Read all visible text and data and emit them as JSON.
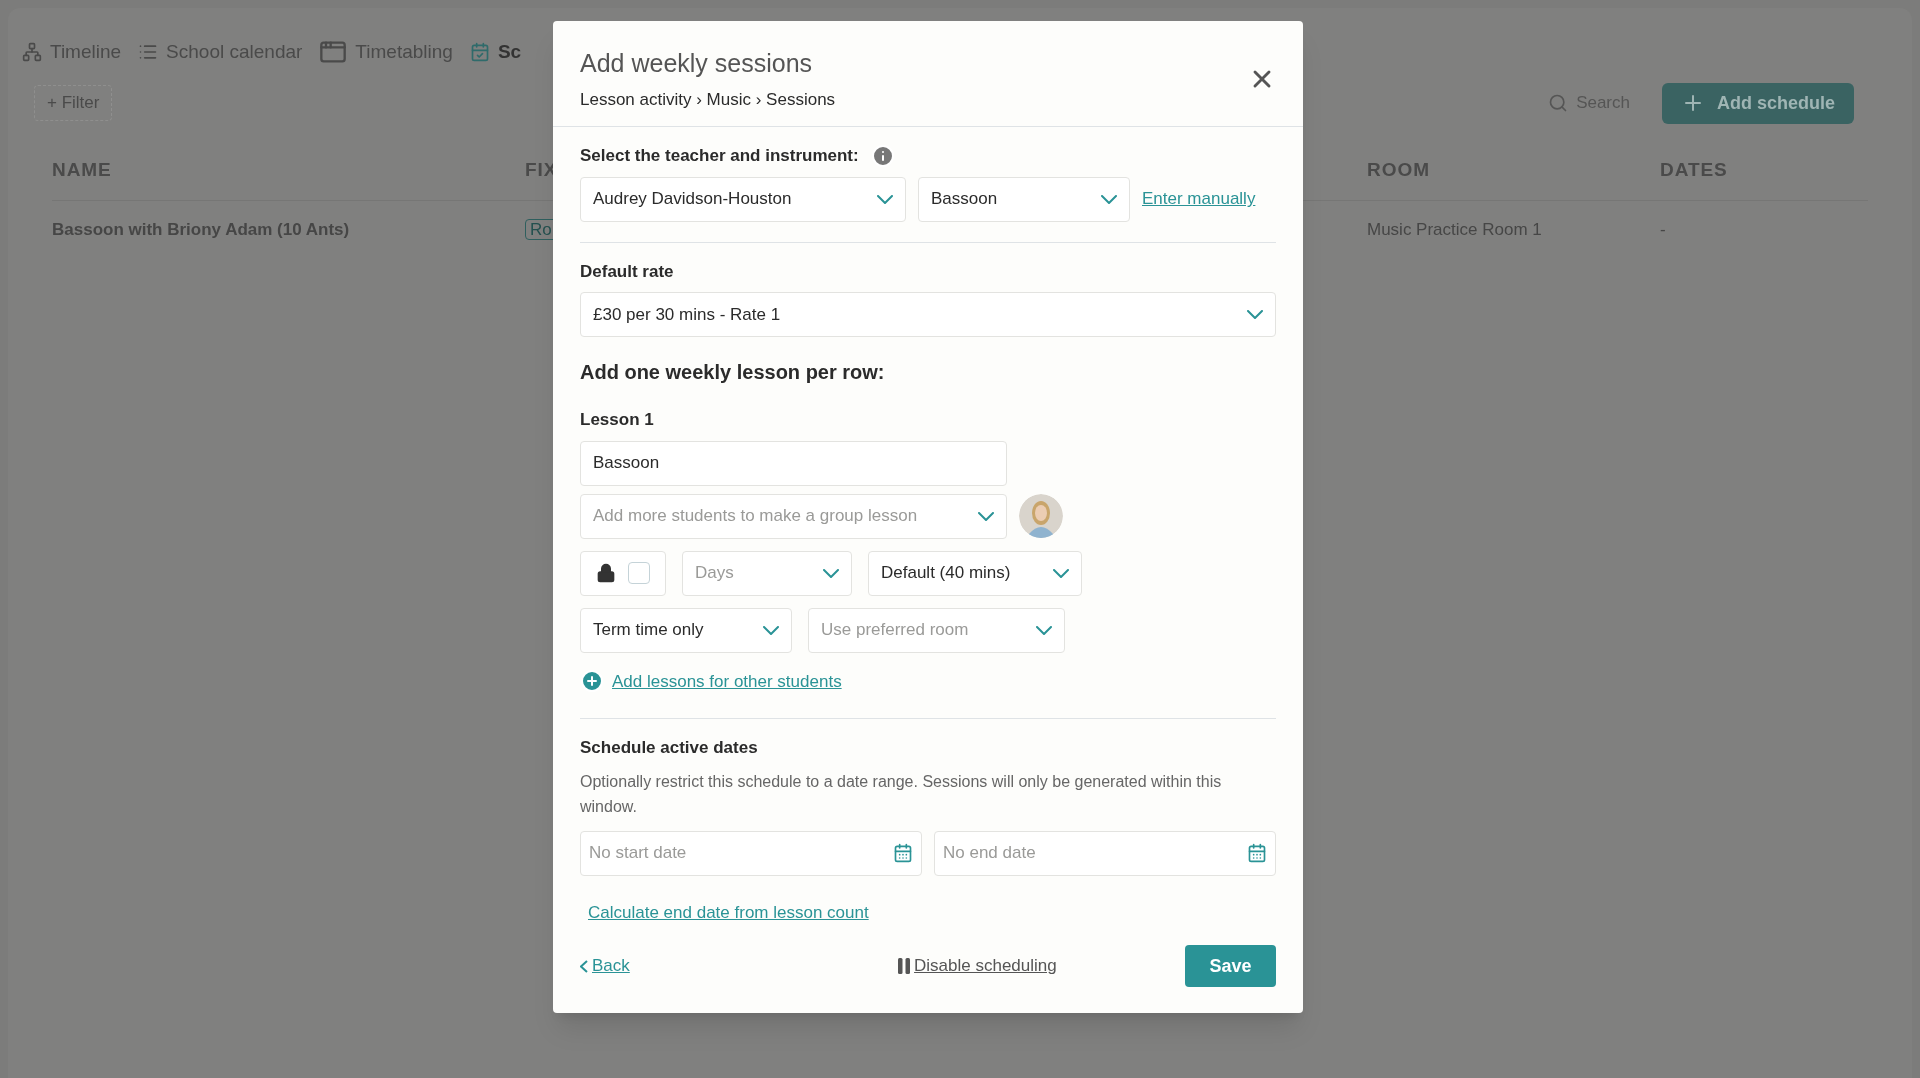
{
  "nav_tabs": [
    {
      "label": "Timeline",
      "kind": "timeline",
      "selected": false
    },
    {
      "label": "School calendar",
      "kind": "list",
      "selected": false
    },
    {
      "label": "Timetabling",
      "kind": "timetable",
      "selected": false
    },
    {
      "label": "Sc",
      "kind": "calendar",
      "selected": true
    }
  ],
  "filter_button": "+ Filter",
  "search": {
    "placeholder": "Search"
  },
  "add_schedule_button": "Add schedule",
  "table": {
    "columns": [
      "NAME",
      "FIX",
      "ROOM",
      "DATES"
    ],
    "rows": [
      {
        "name": "Bassoon with Briony Adam (10 Ants)",
        "column_2": "Ro",
        "room": "Music Practice Room 1",
        "dates": "-"
      }
    ]
  },
  "dialog": {
    "title": "Add weekly sessions",
    "breadcrumb": "Lesson activity › Music › Sessions",
    "teacher_label": "Select the teacher and instrument:",
    "teacher_select": {
      "value": "Audrey Davidson-Houston"
    },
    "instrument_select": {
      "value": "Bassoon"
    },
    "enter_manually_link": "Enter manually",
    "rate_label": "Default rate",
    "rate_select": {
      "value": "£30 per 30 mins - Rate 1"
    },
    "lessons_heading": "Add one weekly lesson per row:",
    "lessons": [
      {
        "label": "Lesson 1",
        "name_field": {
          "value": "Bassoon"
        },
        "students_select": {
          "placeholder": "Add more students to make a group lesson"
        },
        "lock_checkbox": {
          "checked": false
        },
        "days_select": {
          "placeholder": "Days"
        },
        "duration_select": {
          "value": "Default (40 mins)"
        },
        "term_select": {
          "value": "Term time only"
        },
        "room_select": {
          "placeholder": "Use preferred room"
        }
      }
    ],
    "add_lessons_link": "Add lessons for other students",
    "dates_heading": "Schedule active dates",
    "dates_description": "Optionally restrict this schedule to a date range. Sessions will only be generated within this window.",
    "start_date_field": {
      "placeholder": "No start date"
    },
    "end_date_field": {
      "placeholder": "No end date"
    },
    "calculate_link": "Calculate end date from lesson count",
    "back_link": "Back",
    "disable_link": "Disable scheduling",
    "save_button": "Save"
  }
}
